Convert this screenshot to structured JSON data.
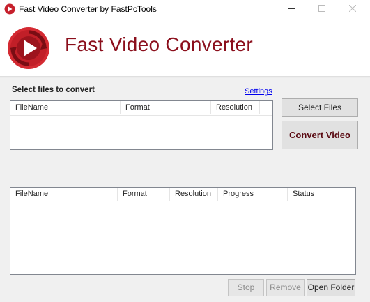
{
  "window": {
    "title": "Fast Video Converter by FastPcTools"
  },
  "header": {
    "app_name": "Fast Video Converter"
  },
  "input_section": {
    "label": "Select files to convert",
    "settings_link": "Settings",
    "columns": [
      "FileName",
      "Format",
      "Resolution",
      ""
    ],
    "rows": []
  },
  "buttons": {
    "select_files": "Select Files",
    "convert_video": "Convert Video",
    "stop": "Stop",
    "remove": "Remove",
    "open_folder": "Open Folder"
  },
  "output_section": {
    "columns": [
      "FileName",
      "Format",
      "Resolution",
      "Progress",
      "Status"
    ],
    "rows": []
  },
  "colors": {
    "brand": "#8b0f1c",
    "logo_red": "#c6202c"
  }
}
